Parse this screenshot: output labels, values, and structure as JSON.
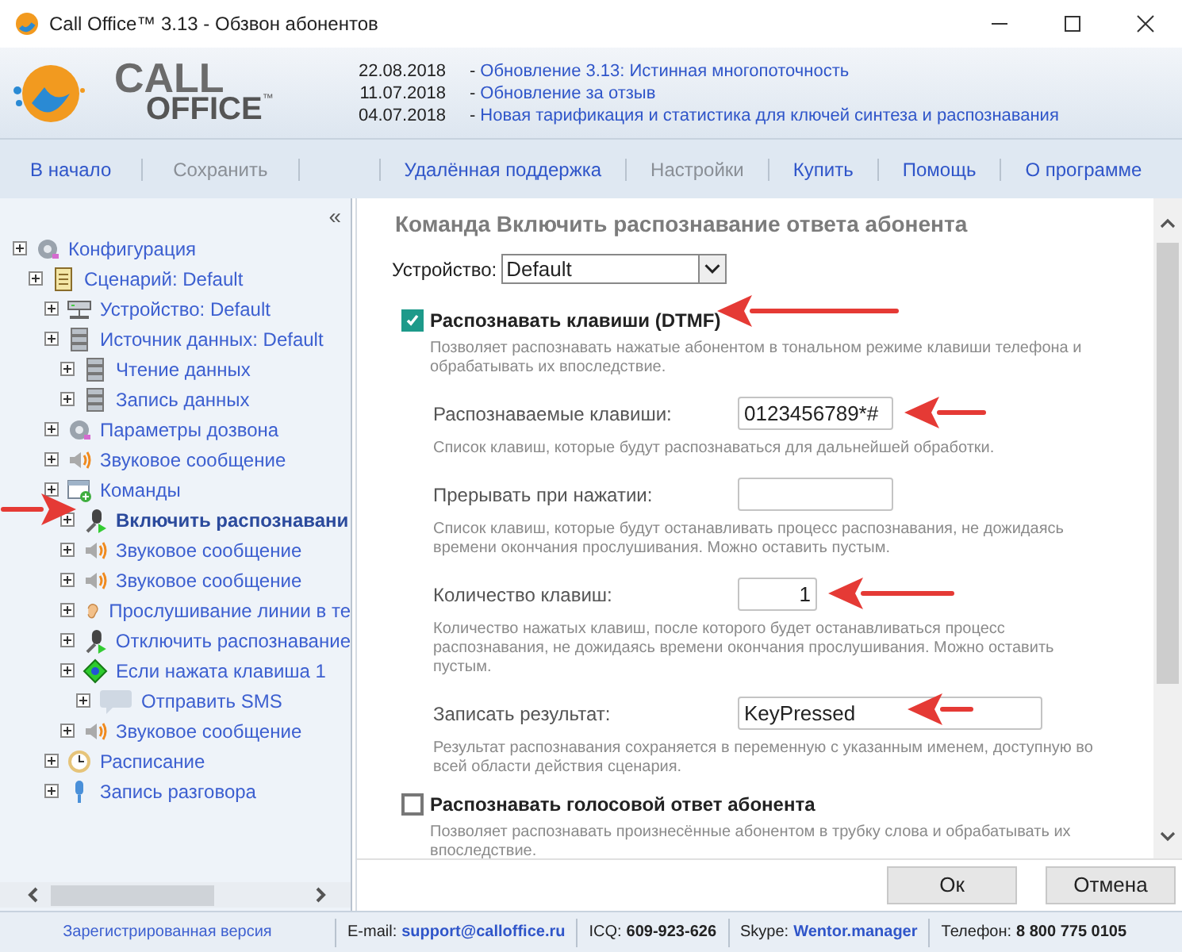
{
  "window": {
    "title": "Call Office™ 3.13 - Обзвон абонентов"
  },
  "logo": {
    "line1": "CALL",
    "line2": "OFFICE",
    "mark": "™"
  },
  "news": [
    {
      "date": "22.08.2018",
      "dash": "-",
      "link": "Обновление 3.13: Истинная многопоточность"
    },
    {
      "date": "11.07.2018",
      "dash": "-",
      "link": "Обновление за отзыв"
    },
    {
      "date": "04.07.2018",
      "dash": "-",
      "link": "Новая тарификация и статистика для ключей синтеза и распознавания"
    }
  ],
  "toolbar_left": [
    {
      "label": "В начало",
      "disabled": false
    },
    {
      "label": "Сохранить",
      "disabled": true
    }
  ],
  "toolbar_right": [
    {
      "label": "Удалённая поддержка",
      "disabled": false
    },
    {
      "label": "Настройки",
      "disabled": true
    },
    {
      "label": "Купить",
      "disabled": false
    },
    {
      "label": "Помощь",
      "disabled": false
    },
    {
      "label": "О программе",
      "disabled": false
    }
  ],
  "sidebar": {
    "collapse": "«",
    "tree": [
      {
        "label": "Конфигурация",
        "kind": "gear",
        "selected": false,
        "children": [
          {
            "label": "Сценарий: Default",
            "kind": "scroll",
            "selected": false,
            "children": [
              {
                "label": "Устройство: Default",
                "kind": "device",
                "selected": false
              },
              {
                "label": "Источник данных: Default",
                "kind": "database",
                "selected": false,
                "children": [
                  {
                    "label": "Чтение данных",
                    "kind": "database",
                    "selected": false
                  },
                  {
                    "label": "Запись данных",
                    "kind": "database",
                    "selected": false
                  }
                ]
              },
              {
                "label": "Параметры дозвона",
                "kind": "gear",
                "selected": false
              },
              {
                "label": "Звуковое сообщение",
                "kind": "speaker",
                "selected": false
              },
              {
                "label": "Команды",
                "kind": "commands",
                "selected": false,
                "children": [
                  {
                    "label": "Включить распознавани",
                    "kind": "mic",
                    "selected": true
                  },
                  {
                    "label": "Звуковое сообщение",
                    "kind": "speaker",
                    "selected": false
                  },
                  {
                    "label": "Звуковое сообщение",
                    "kind": "speaker",
                    "selected": false
                  },
                  {
                    "label": "Прослушивание линии в те",
                    "kind": "ear",
                    "selected": false
                  },
                  {
                    "label": "Отключить распознавание",
                    "kind": "mic",
                    "selected": false
                  },
                  {
                    "label": "Если нажата клавиша 1",
                    "kind": "diamond",
                    "selected": false,
                    "children": [
                      {
                        "label": "Отправить SMS",
                        "kind": "sms",
                        "selected": false
                      }
                    ]
                  },
                  {
                    "label": "Звуковое сообщение",
                    "kind": "speaker",
                    "selected": false
                  }
                ]
              },
              {
                "label": "Расписание",
                "kind": "clock",
                "selected": false
              },
              {
                "label": "Запись разговора",
                "kind": "microphone",
                "selected": false
              }
            ]
          }
        ]
      }
    ]
  },
  "panel": {
    "title": "Команда Включить распознавание ответа абонента",
    "device": {
      "label": "Устройство:",
      "value": "Default"
    },
    "sections": [
      {
        "label": "Распознавать клавиши (DTMF)",
        "checked": true,
        "description": "Позволяет распознавать нажатые абонентом в тональном режиме клавиши телефона и обрабатывать их впоследствие.",
        "fields": [
          {
            "label": "Распознаваемые клавиши:",
            "value": "0123456789*#",
            "kind": "medium",
            "description": "Список клавиш, которые будут распознаваться для дальнейшей обработки."
          },
          {
            "label": "Прерывать при нажатии:",
            "kind": "medium",
            "description": "Список клавиш, которые будут останавливать процесс распознавания, не дожидаясь времени окончания прослушивания. Можно оставить пустым."
          },
          {
            "label": "Количество клавиш:",
            "value": "1",
            "kind": "number",
            "description": "Количество нажатых клавиш, после которого будет останавливаться процесс распознавания, не дожидаясь времени окончания прослушивания. Можно оставить пустым."
          },
          {
            "label": "Записать результат:",
            "value": "KeyPressed",
            "kind": "wide",
            "description": "Результат распознавания сохраняется в переменную с указанным именем, доступную во всей области действия сценария."
          }
        ]
      },
      {
        "label": "Распознавать голосовой ответ абонента",
        "checked": false,
        "description": "Позволяет распознавать произнесённые абонентом в трубку слова и обрабатывать их впоследствие."
      }
    ],
    "buttons": [
      "Ок",
      "Отмена"
    ]
  },
  "status_bar": {
    "version": "Зарегистрированная версия",
    "items": [
      {
        "label": "E-mail:",
        "value": "support@calloffice.ru",
        "kind": "link"
      },
      {
        "label": "ICQ:",
        "value": "609-923-626",
        "kind": "plain"
      },
      {
        "label": "Skype:",
        "value": "Wentor.manager",
        "kind": "link"
      },
      {
        "label": "Телефон:",
        "value": "8 800 775 0105",
        "kind": "plain"
      }
    ]
  }
}
